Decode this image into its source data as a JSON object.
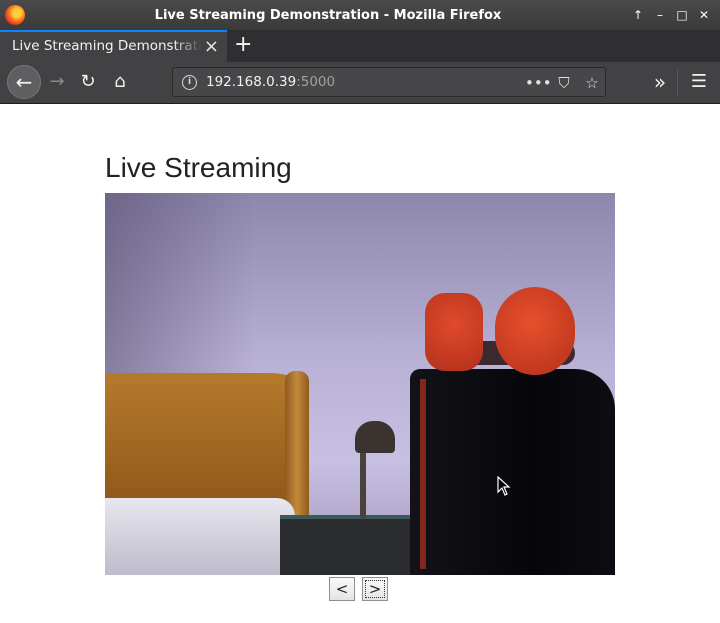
{
  "window": {
    "title": "Live Streaming Demonstration - Mozilla Firefox"
  },
  "tab": {
    "label": "Live Streaming Demonstration",
    "close": "×"
  },
  "newtab": {
    "label": "+"
  },
  "nav": {
    "back": "←",
    "forward": "→",
    "reload": "↻",
    "home": "⌂",
    "url_host": "192.168.0.39",
    "url_port": ":5000",
    "info": "i",
    "page_actions": "•••",
    "pocket": "⛉",
    "bookmark": "☆",
    "overflow": "»",
    "menu": "☰"
  },
  "page": {
    "title": "Live Streaming",
    "prev_label": "<",
    "next_label": ">"
  },
  "icons": {
    "minimize": "–",
    "maximize": "□",
    "close": "✕",
    "pin": "↑"
  },
  "colors": {
    "tab_accent": "#0a84ff",
    "toolbar": "#424244",
    "titlebar": "#3a3a3a"
  }
}
